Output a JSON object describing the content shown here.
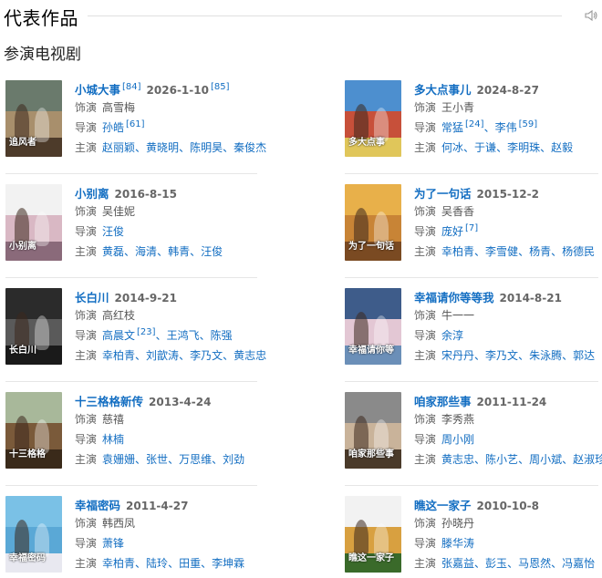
{
  "header": {
    "title": "代表作品"
  },
  "section_title": "参演电视剧",
  "labels": {
    "role": "饰演",
    "director": "导演",
    "cast": "主演"
  },
  "colors": {
    "link": "#136ec2",
    "text": "#333333",
    "muted": "#666666",
    "divider": "#e6e6e6"
  },
  "dramas": [
    {
      "title": "小城大事",
      "title_ref": "[84]",
      "date": "2026-1-10",
      "date_ref": "[85]",
      "role": "高雪梅",
      "directors": [
        {
          "name": "孙皓",
          "ref": "[61]"
        }
      ],
      "cast": [
        "赵丽颖",
        "黄晓明",
        "陈明昊",
        "秦俊杰"
      ],
      "poster_text": "追风者",
      "poster_colors": [
        "#6a7a6c",
        "#a88f6c",
        "#4d3b2a"
      ]
    },
    {
      "title": "多大点事儿",
      "title_ref": "",
      "date": "2024-8-27",
      "date_ref": "",
      "role": "王小青",
      "directors": [
        {
          "name": "常猛",
          "ref": "[24]"
        },
        {
          "name": "李伟",
          "ref": "[59]"
        }
      ],
      "cast": [
        "何冰",
        "于谦",
        "李明珠",
        "赵毅"
      ],
      "poster_text": "多大点事",
      "poster_colors": [
        "#4d8fcf",
        "#c7503a",
        "#e0c65a"
      ]
    },
    {
      "title": "小别离",
      "title_ref": "",
      "date": "2016-8-15",
      "date_ref": "",
      "role": "吴佳妮",
      "directors": [
        {
          "name": "汪俊",
          "ref": ""
        }
      ],
      "cast": [
        "黄磊",
        "海清",
        "韩青",
        "汪俊"
      ],
      "poster_text": "小别离",
      "poster_colors": [
        "#f2f2f2",
        "#d9b8c4",
        "#8a6a7a"
      ]
    },
    {
      "title": "为了一句话",
      "title_ref": "",
      "date": "2015-12-2",
      "date_ref": "",
      "role": "吴香香",
      "directors": [
        {
          "name": "庞好",
          "ref": "[7]"
        }
      ],
      "cast": [
        "幸柏青",
        "李雪健",
        "杨青",
        "杨德民"
      ],
      "poster_text": "为了一句话",
      "poster_colors": [
        "#e8b04a",
        "#c88436",
        "#7a4a22"
      ]
    },
    {
      "title": "长白川",
      "title_ref": "",
      "date": "2014-9-21",
      "date_ref": "",
      "role": "高红枝",
      "directors": [
        {
          "name": "高晨文",
          "ref": "[23]"
        },
        {
          "name": "王鸿飞",
          "ref": ""
        },
        {
          "name": "陈强",
          "ref": ""
        }
      ],
      "cast": [
        "幸柏青",
        "刘歆涛",
        "李乃文",
        "黄志忠"
      ],
      "poster_text": "长白川",
      "poster_colors": [
        "#2b2b2b",
        "#5a5a5a",
        "#1a1a1a"
      ]
    },
    {
      "title": "幸福请你等等我",
      "title_ref": "",
      "date": "2014-8-21",
      "date_ref": "",
      "role": "牛一一",
      "directors": [
        {
          "name": "余淳",
          "ref": ""
        }
      ],
      "cast": [
        "宋丹丹",
        "李乃文",
        "朱泳腾",
        "郭达"
      ],
      "poster_text": "幸福请你等",
      "poster_colors": [
        "#3e5c8a",
        "#e3c7d4",
        "#6b8fb8"
      ]
    },
    {
      "title": "十三格格新传",
      "title_ref": "",
      "date": "2013-4-24",
      "date_ref": "",
      "role": "慈禧",
      "directors": [
        {
          "name": "林楠",
          "ref": ""
        }
      ],
      "cast": [
        "袁姗姗",
        "张世",
        "万思维",
        "刘劲"
      ],
      "poster_text": "十三格格",
      "poster_colors": [
        "#a8b89a",
        "#7a5a3a",
        "#3a2a1a"
      ]
    },
    {
      "title": "咱家那些事",
      "title_ref": "",
      "date": "2011-11-24",
      "date_ref": "",
      "role": "李秀燕",
      "directors": [
        {
          "name": "周小刚",
          "ref": ""
        }
      ],
      "cast": [
        "黄志忠",
        "陈小艺",
        "周小斌",
        "赵淑珍"
      ],
      "poster_text": "咱家那些事",
      "poster_colors": [
        "#8a8a8a",
        "#c9b39a",
        "#4a3a2a"
      ]
    },
    {
      "title": "幸福密码",
      "title_ref": "",
      "date": "2011-4-27",
      "date_ref": "",
      "role": "韩西凤",
      "directors": [
        {
          "name": "萧锋",
          "ref": ""
        }
      ],
      "cast": [
        "幸柏青",
        "陆玲",
        "田重",
        "李坤霖"
      ],
      "poster_text": "幸福密码",
      "poster_colors": [
        "#7ac1e6",
        "#5aa8d6",
        "#e8e8f0"
      ]
    },
    {
      "title": "瞧这一家子",
      "title_ref": "",
      "date": "2010-10-8",
      "date_ref": "",
      "role": "孙晓丹",
      "directors": [
        {
          "name": "滕华涛",
          "ref": ""
        }
      ],
      "cast": [
        "张嘉益",
        "彭玉",
        "马恩然",
        "冯嘉怡"
      ],
      "poster_text": "瞧这一家子",
      "poster_colors": [
        "#f2f2f2",
        "#d8a040",
        "#3a6a2a"
      ]
    }
  ]
}
